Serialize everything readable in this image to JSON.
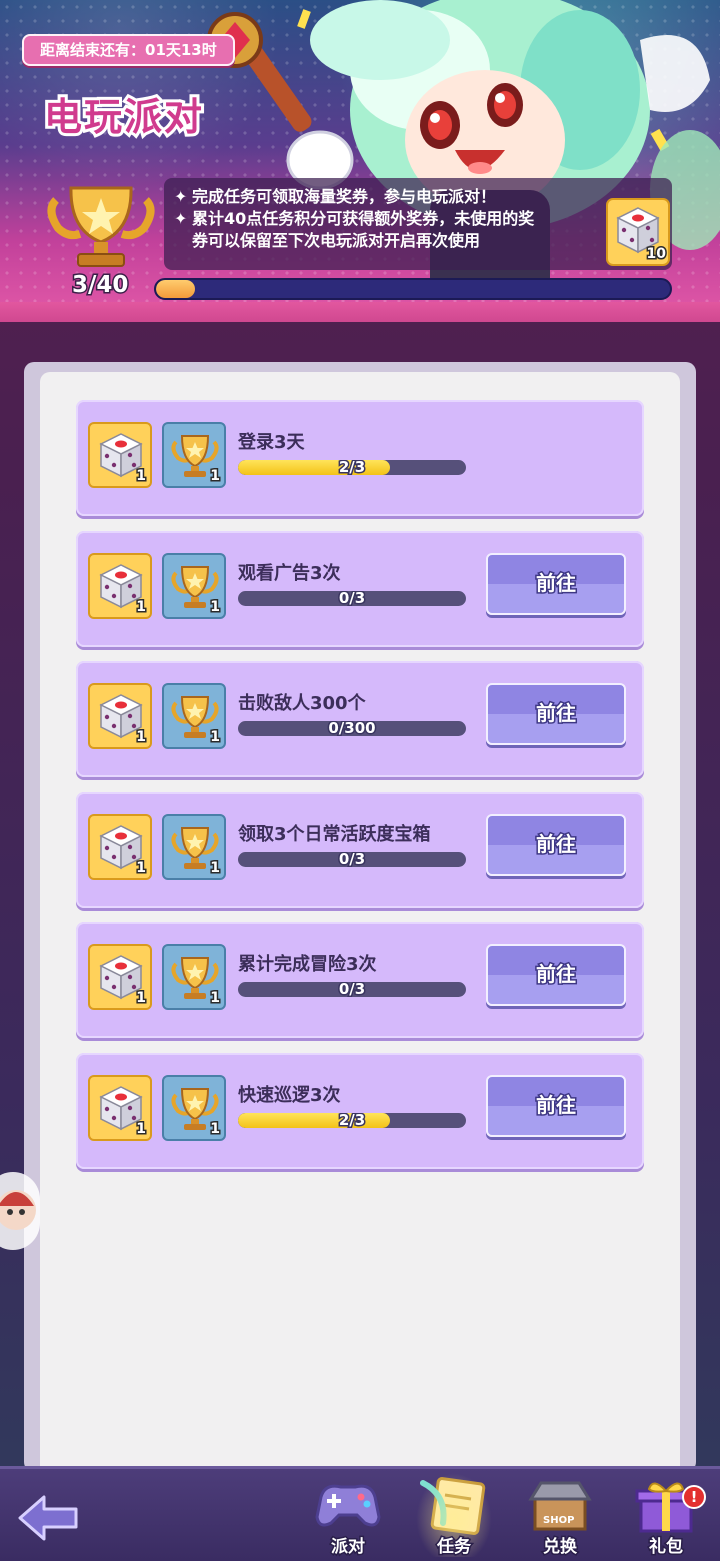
{
  "header": {
    "timer_text": "距离结束还有：01天13时",
    "title": "电玩派对",
    "score": "3/40",
    "score_progress": 0.075,
    "desc": {
      "line1": "完成任务可领取海量奖券，参与电玩派对！",
      "line2": "累计40点任务积分可获得额外奖券，未使用的奖",
      "line3": "券可以保留至下次电玩派对开启再次使用"
    },
    "reward": {
      "icon": "dice-ticket-icon",
      "count": "10"
    }
  },
  "tasks": [
    {
      "title": "登录3天",
      "progress_text": "2/3",
      "progress": 0.667,
      "dice_count": "1",
      "trophy_count": "1",
      "button": ""
    },
    {
      "title": "观看广告3次",
      "progress_text": "0/3",
      "progress": 0,
      "dice_count": "1",
      "trophy_count": "1",
      "button": "前往"
    },
    {
      "title": "击败敌人300个",
      "progress_text": "0/300",
      "progress": 0,
      "dice_count": "1",
      "trophy_count": "1",
      "button": "前往"
    },
    {
      "title": "领取3个日常活跃度宝箱",
      "progress_text": "0/3",
      "progress": 0,
      "dice_count": "1",
      "trophy_count": "1",
      "button": "前往"
    },
    {
      "title": "累计完成冒险3次",
      "progress_text": "0/3",
      "progress": 0,
      "dice_count": "1",
      "trophy_count": "1",
      "button": "前往"
    },
    {
      "title": "快速巡逻3次",
      "progress_text": "2/3",
      "progress": 0.667,
      "dice_count": "1",
      "trophy_count": "1",
      "button": "前往"
    }
  ],
  "nav": {
    "back_icon": "back-arrow-icon",
    "items": [
      {
        "label": "派对",
        "icon": "gamepad-icon",
        "active": false
      },
      {
        "label": "任务",
        "icon": "task-scroll-icon",
        "active": true
      },
      {
        "label": "兑换",
        "icon": "shop-icon",
        "active": false
      },
      {
        "label": "礼包",
        "icon": "gift-icon",
        "active": false,
        "badge": "!"
      }
    ]
  },
  "colors": {
    "task_card": "#d5b9fb",
    "go_button": "#8f85e3",
    "progress_yellow": "#f3c218",
    "progress_track": "#56507a"
  }
}
